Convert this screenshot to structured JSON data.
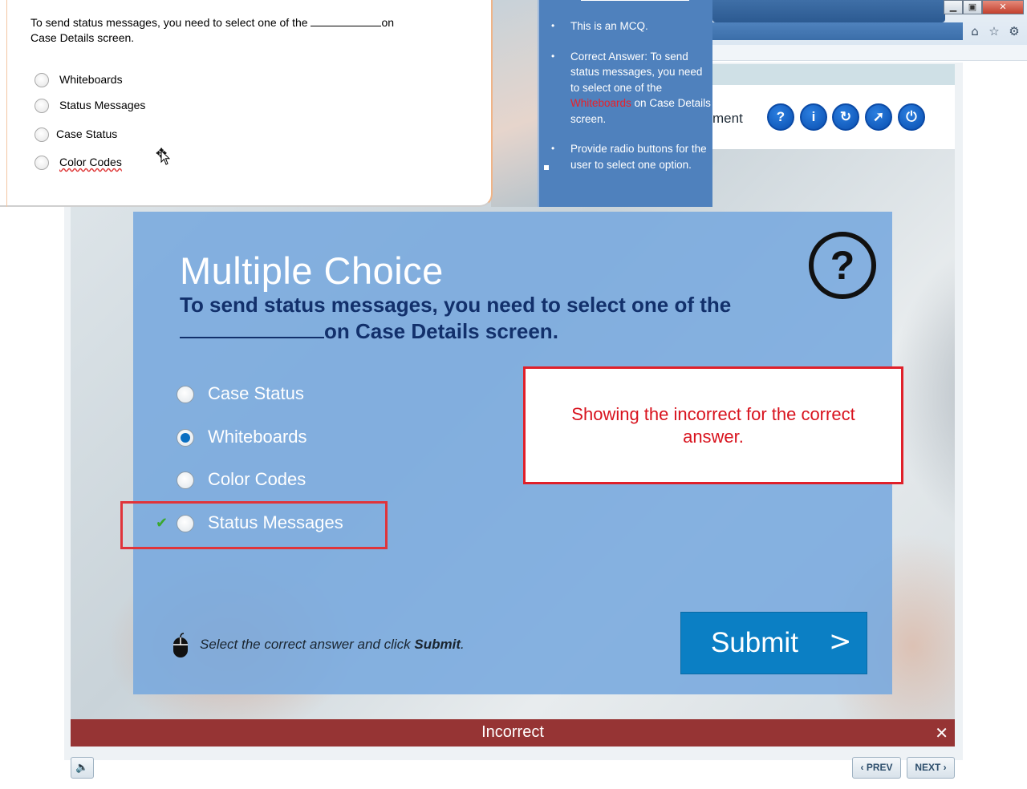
{
  "browser": {
    "window_buttons": {
      "minimize": "▁",
      "maximize": "▣",
      "close": "✕"
    },
    "toolbar_icons": [
      "home-icon",
      "star-icon",
      "gear-icon"
    ]
  },
  "player": {
    "header_title_fragment": "ment",
    "header_buttons": [
      {
        "name": "help-button",
        "glyph": "?"
      },
      {
        "name": "info-button",
        "glyph": "i"
      },
      {
        "name": "restart-button",
        "glyph": "↻"
      },
      {
        "name": "compass-button",
        "glyph": "➚"
      },
      {
        "name": "power-button",
        "glyph": "⏻"
      }
    ],
    "slide": {
      "title": "Multiple Choice",
      "question_part1": "To send status messages, you need to select one of the",
      "question_part2": "on Case Details screen.",
      "options": [
        {
          "label": "Case Status",
          "selected": false
        },
        {
          "label": "Whiteboards",
          "selected": true
        },
        {
          "label": "Color Codes",
          "selected": false
        },
        {
          "label": "Status Messages",
          "selected": false
        }
      ],
      "correct_mark": "✔",
      "instruction_prefix": "Select the correct answer and click ",
      "instruction_bold": "Submit",
      "instruction_suffix": ".",
      "submit_label": "Submit",
      "submit_chevron": ">"
    },
    "annotation_note": "Showing the incorrect for the correct answer.",
    "feedback": {
      "text": "Incorrect",
      "close": "✕"
    },
    "footer": {
      "audio_icon": "🔈",
      "prev_label": "PREV",
      "next_label": "NEXT",
      "prev_chevron": "‹",
      "next_chevron": "›"
    }
  },
  "storyboard_doc": {
    "question_part1": "To send status messages, you need to select one of the",
    "question_part2": "on Case Details screen.",
    "options": [
      "Whiteboards",
      "Status Messages",
      "Case Status",
      "Color Codes"
    ]
  },
  "storyboard_notes": {
    "items": [
      {
        "text": "This is an MCQ."
      },
      {
        "pre": "Correct Answer: To send status messages, you need to select one of the ",
        "highlight": "Whiteboards",
        "post": " on Case Details screen."
      },
      {
        "text": "Provide radio buttons for the user to select one option."
      }
    ]
  },
  "colors": {
    "slide_bg": "#78a8de",
    "question_text": "#12306b",
    "submit_bg": "#0b7fc4",
    "feedback_bg": "#963434",
    "annotation_red": "#e0202a",
    "notes_bg": "#4f81bd"
  }
}
